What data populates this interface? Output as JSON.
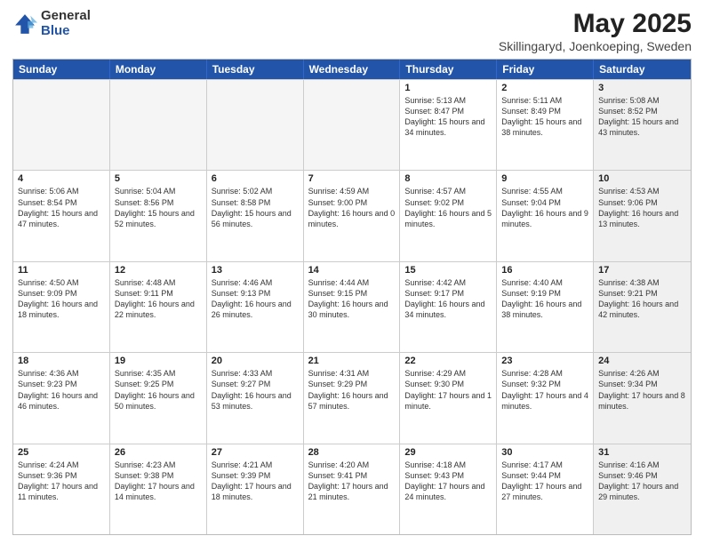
{
  "logo": {
    "general": "General",
    "blue": "Blue"
  },
  "title": {
    "month": "May 2025",
    "location": "Skillingaryd, Joenkoeping, Sweden"
  },
  "header_days": [
    "Sunday",
    "Monday",
    "Tuesday",
    "Wednesday",
    "Thursday",
    "Friday",
    "Saturday"
  ],
  "rows": [
    [
      {
        "day": "",
        "info": "",
        "empty": true
      },
      {
        "day": "",
        "info": "",
        "empty": true
      },
      {
        "day": "",
        "info": "",
        "empty": true
      },
      {
        "day": "",
        "info": "",
        "empty": true
      },
      {
        "day": "1",
        "info": "Sunrise: 5:13 AM\nSunset: 8:47 PM\nDaylight: 15 hours and 34 minutes.",
        "empty": false
      },
      {
        "day": "2",
        "info": "Sunrise: 5:11 AM\nSunset: 8:49 PM\nDaylight: 15 hours and 38 minutes.",
        "empty": false
      },
      {
        "day": "3",
        "info": "Sunrise: 5:08 AM\nSunset: 8:52 PM\nDaylight: 15 hours and 43 minutes.",
        "empty": false,
        "shaded": true
      }
    ],
    [
      {
        "day": "4",
        "info": "Sunrise: 5:06 AM\nSunset: 8:54 PM\nDaylight: 15 hours and 47 minutes.",
        "empty": false
      },
      {
        "day": "5",
        "info": "Sunrise: 5:04 AM\nSunset: 8:56 PM\nDaylight: 15 hours and 52 minutes.",
        "empty": false
      },
      {
        "day": "6",
        "info": "Sunrise: 5:02 AM\nSunset: 8:58 PM\nDaylight: 15 hours and 56 minutes.",
        "empty": false
      },
      {
        "day": "7",
        "info": "Sunrise: 4:59 AM\nSunset: 9:00 PM\nDaylight: 16 hours and 0 minutes.",
        "empty": false
      },
      {
        "day": "8",
        "info": "Sunrise: 4:57 AM\nSunset: 9:02 PM\nDaylight: 16 hours and 5 minutes.",
        "empty": false
      },
      {
        "day": "9",
        "info": "Sunrise: 4:55 AM\nSunset: 9:04 PM\nDaylight: 16 hours and 9 minutes.",
        "empty": false
      },
      {
        "day": "10",
        "info": "Sunrise: 4:53 AM\nSunset: 9:06 PM\nDaylight: 16 hours and 13 minutes.",
        "empty": false,
        "shaded": true
      }
    ],
    [
      {
        "day": "11",
        "info": "Sunrise: 4:50 AM\nSunset: 9:09 PM\nDaylight: 16 hours and 18 minutes.",
        "empty": false
      },
      {
        "day": "12",
        "info": "Sunrise: 4:48 AM\nSunset: 9:11 PM\nDaylight: 16 hours and 22 minutes.",
        "empty": false
      },
      {
        "day": "13",
        "info": "Sunrise: 4:46 AM\nSunset: 9:13 PM\nDaylight: 16 hours and 26 minutes.",
        "empty": false
      },
      {
        "day": "14",
        "info": "Sunrise: 4:44 AM\nSunset: 9:15 PM\nDaylight: 16 hours and 30 minutes.",
        "empty": false
      },
      {
        "day": "15",
        "info": "Sunrise: 4:42 AM\nSunset: 9:17 PM\nDaylight: 16 hours and 34 minutes.",
        "empty": false
      },
      {
        "day": "16",
        "info": "Sunrise: 4:40 AM\nSunset: 9:19 PM\nDaylight: 16 hours and 38 minutes.",
        "empty": false
      },
      {
        "day": "17",
        "info": "Sunrise: 4:38 AM\nSunset: 9:21 PM\nDaylight: 16 hours and 42 minutes.",
        "empty": false,
        "shaded": true
      }
    ],
    [
      {
        "day": "18",
        "info": "Sunrise: 4:36 AM\nSunset: 9:23 PM\nDaylight: 16 hours and 46 minutes.",
        "empty": false
      },
      {
        "day": "19",
        "info": "Sunrise: 4:35 AM\nSunset: 9:25 PM\nDaylight: 16 hours and 50 minutes.",
        "empty": false
      },
      {
        "day": "20",
        "info": "Sunrise: 4:33 AM\nSunset: 9:27 PM\nDaylight: 16 hours and 53 minutes.",
        "empty": false
      },
      {
        "day": "21",
        "info": "Sunrise: 4:31 AM\nSunset: 9:29 PM\nDaylight: 16 hours and 57 minutes.",
        "empty": false
      },
      {
        "day": "22",
        "info": "Sunrise: 4:29 AM\nSunset: 9:30 PM\nDaylight: 17 hours and 1 minute.",
        "empty": false
      },
      {
        "day": "23",
        "info": "Sunrise: 4:28 AM\nSunset: 9:32 PM\nDaylight: 17 hours and 4 minutes.",
        "empty": false
      },
      {
        "day": "24",
        "info": "Sunrise: 4:26 AM\nSunset: 9:34 PM\nDaylight: 17 hours and 8 minutes.",
        "empty": false,
        "shaded": true
      }
    ],
    [
      {
        "day": "25",
        "info": "Sunrise: 4:24 AM\nSunset: 9:36 PM\nDaylight: 17 hours and 11 minutes.",
        "empty": false
      },
      {
        "day": "26",
        "info": "Sunrise: 4:23 AM\nSunset: 9:38 PM\nDaylight: 17 hours and 14 minutes.",
        "empty": false
      },
      {
        "day": "27",
        "info": "Sunrise: 4:21 AM\nSunset: 9:39 PM\nDaylight: 17 hours and 18 minutes.",
        "empty": false
      },
      {
        "day": "28",
        "info": "Sunrise: 4:20 AM\nSunset: 9:41 PM\nDaylight: 17 hours and 21 minutes.",
        "empty": false
      },
      {
        "day": "29",
        "info": "Sunrise: 4:18 AM\nSunset: 9:43 PM\nDaylight: 17 hours and 24 minutes.",
        "empty": false
      },
      {
        "day": "30",
        "info": "Sunrise: 4:17 AM\nSunset: 9:44 PM\nDaylight: 17 hours and 27 minutes.",
        "empty": false
      },
      {
        "day": "31",
        "info": "Sunrise: 4:16 AM\nSunset: 9:46 PM\nDaylight: 17 hours and 29 minutes.",
        "empty": false,
        "shaded": true
      }
    ]
  ]
}
